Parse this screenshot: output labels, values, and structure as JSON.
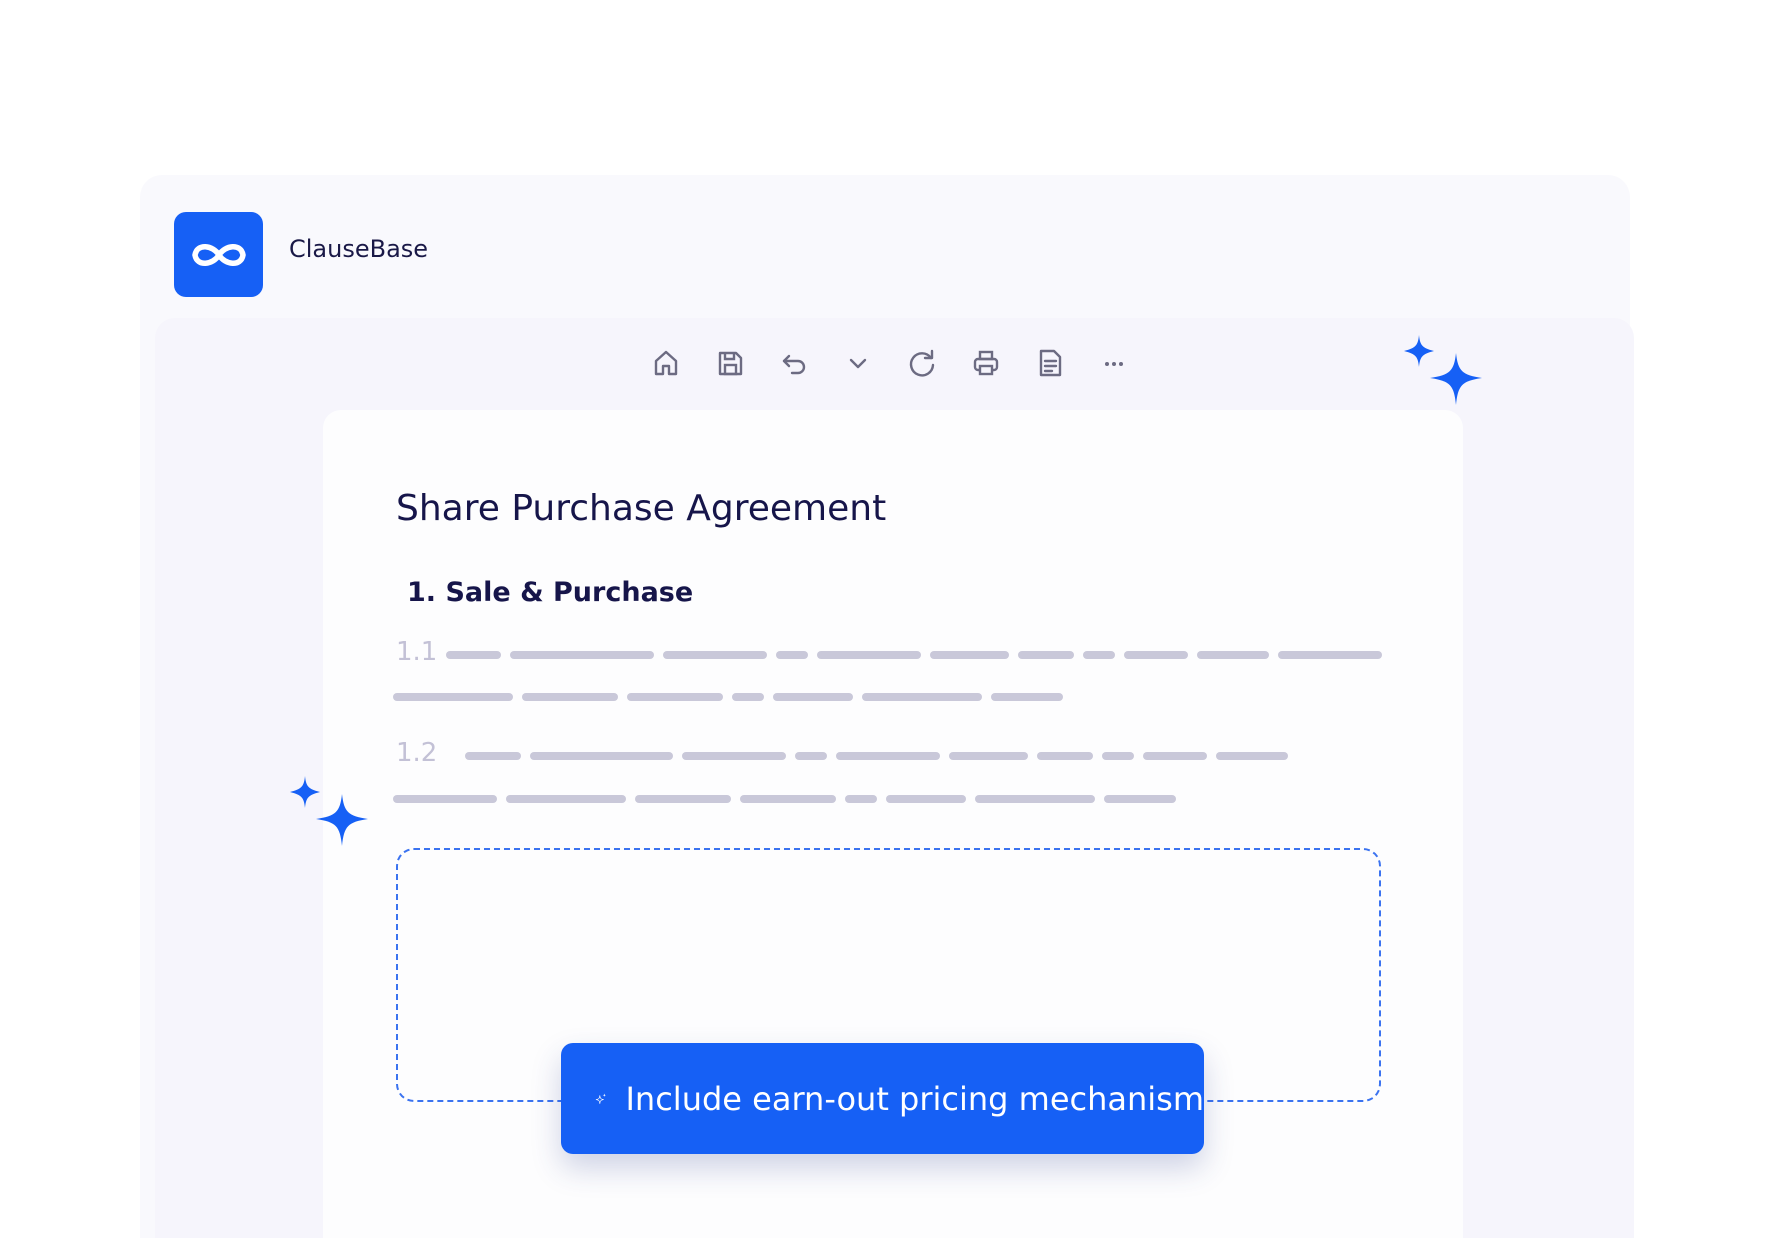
{
  "brand": {
    "name": "ClauseBase",
    "logo_icon": "infinity-icon",
    "accent_color": "#1660f5"
  },
  "toolbar": {
    "buttons": [
      {
        "icon": "home-icon"
      },
      {
        "icon": "save-icon"
      },
      {
        "icon": "undo-icon"
      },
      {
        "icon": "chevron-down-icon"
      },
      {
        "icon": "refresh-icon"
      },
      {
        "icon": "print-icon"
      },
      {
        "icon": "document-icon"
      },
      {
        "icon": "more-icon"
      }
    ]
  },
  "document": {
    "title": "Share Purchase Agreement",
    "section": {
      "heading": "1. Sale & Purchase",
      "clauses": [
        {
          "number": "1.1"
        },
        {
          "number": "1.2"
        }
      ]
    }
  },
  "ai_prompt": {
    "text": "Include earn-out pricing mechanism",
    "icon": "sparkles-icon"
  }
}
